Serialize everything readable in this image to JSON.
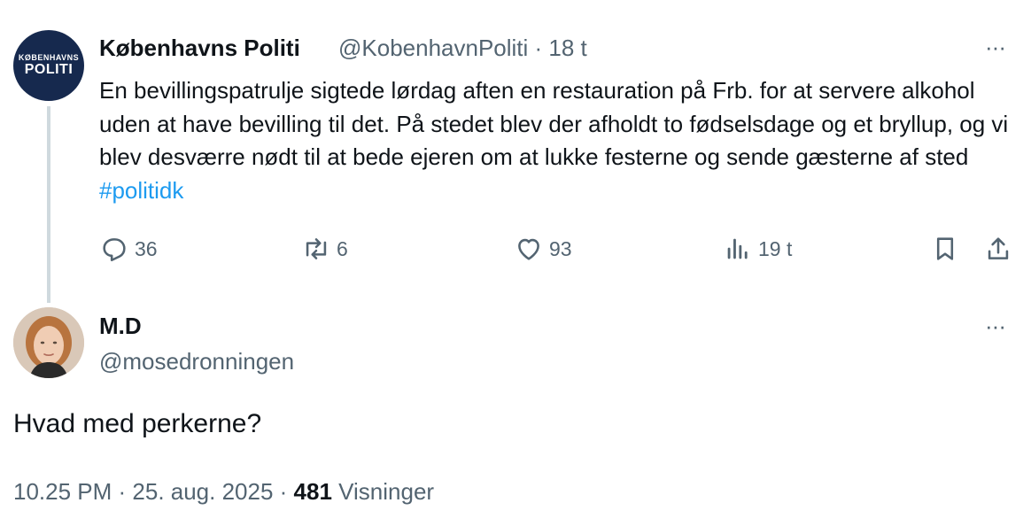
{
  "tweet": {
    "avatar_text_small": "KØBENHAVNS",
    "avatar_text_big": "POLITI",
    "author": "Københavns Politi",
    "handle_time": "@KobenhavnPoliti · 18 t",
    "body_text": "En bevillingspatrulje sigtede lørdag aften en restauration på Frb. for at servere alkohol uden at have bevilling til det. På stedet blev der afholdt to fødselsdage og et bryllup, og vi blev desværre nødt til at bede ejeren om at lukke festerne og sende gæsterne af sted ",
    "hashtag": "#politidk",
    "more": "···",
    "replies": "36",
    "reposts": "6",
    "likes": "93",
    "views": "19 t"
  },
  "reply": {
    "author": "M.D",
    "handle": "@mosedronningen",
    "more": "···",
    "text": "Hvad med perkerne?",
    "timestamp": "10.25 PM · 25. aug. 2025 · ",
    "views_count": "481",
    "views_label": " Visninger"
  },
  "colors": {
    "accent": "#1d9bf0",
    "secondary_text": "#536471",
    "police_navy": "#16294e"
  }
}
